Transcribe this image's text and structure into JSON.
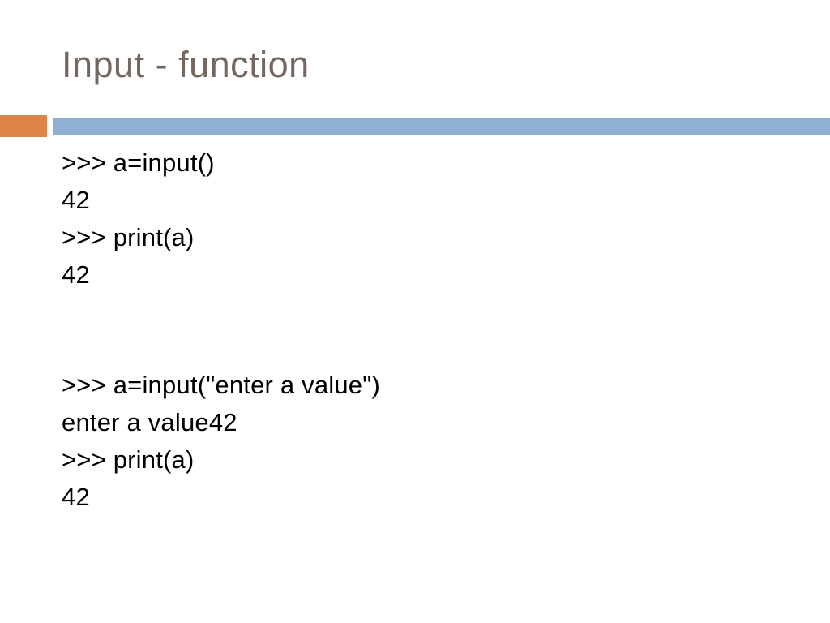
{
  "slide": {
    "title": "Input - function",
    "title_color": "#756660",
    "background_color": "#ffffff"
  },
  "divider": {
    "accent_block_color": "#dd8449",
    "accent_bar_color": "#8fb0d3"
  },
  "body": {
    "text_color": "#000000",
    "blocks": [
      {
        "lines": [
          ">>> a=input()",
          "42",
          ">>> print(a)",
          "42"
        ]
      },
      {
        "lines": [
          ">>> a=input(\"enter a value\")",
          "enter a value42",
          ">>> print(a)",
          "42"
        ]
      }
    ]
  }
}
